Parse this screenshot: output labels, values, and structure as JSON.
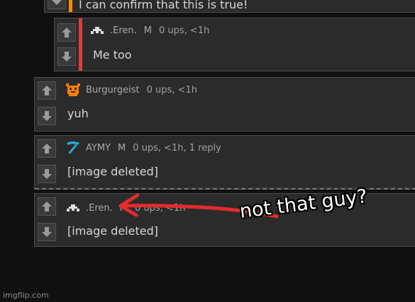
{
  "colors": {
    "panel_bg": "#2b2b2b",
    "panel_border": "#4b4b4b",
    "accent_orange": "#ff8c00",
    "accent_red": "#e33b3b",
    "annotation_red": "#e52b2b",
    "avatar_orange": "#ff7f00",
    "avatar_cyan": "#2aa7d8"
  },
  "comments": [
    {
      "text": "I can confirm that this is true!",
      "accent": "orange"
    },
    {
      "user": ".Eren.",
      "tag": "M",
      "stats": "0 ups, <1h",
      "text": "Me too",
      "avatar_icon": "space-invader-icon",
      "accent": "red"
    },
    {
      "user": "Burgurgeist",
      "stats": "0 ups, <1h",
      "text": "yuh",
      "avatar_icon": "orange-creature-icon"
    },
    {
      "user": "AYMY",
      "tag": "M",
      "stats": "0 ups, <1h, 1 reply",
      "text": "[image deleted]",
      "avatar_icon": "pickaxe-icon"
    },
    {
      "user": ".Eren.",
      "tag": "M",
      "stats": "0 ups, <1h",
      "text": "[image deleted]",
      "avatar_icon": "space-invader-icon"
    }
  ],
  "annotation": {
    "text": "not that guy?",
    "arrow_icon": "red-arrow-icon"
  },
  "watermark": "imgflip.com"
}
